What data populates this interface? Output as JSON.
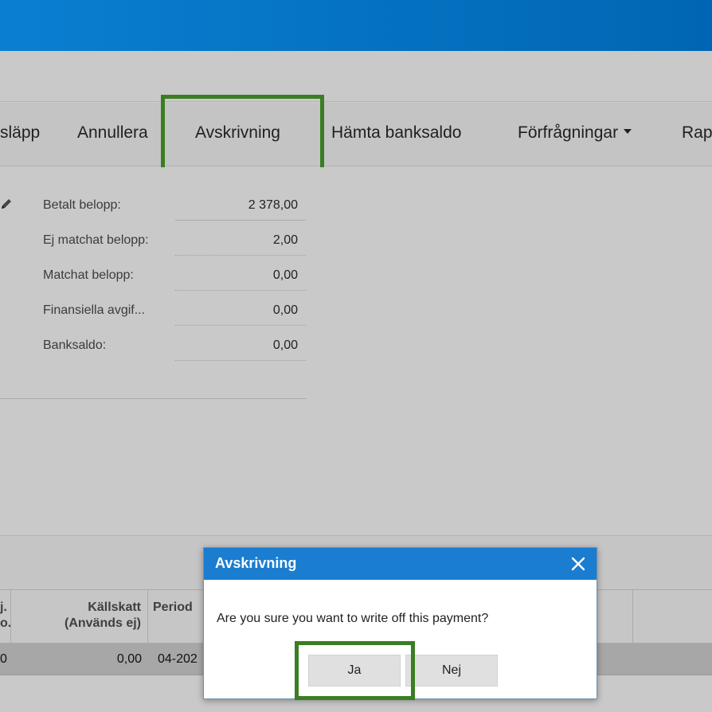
{
  "toolbar": {
    "items": [
      {
        "label": "släpp"
      },
      {
        "label": "Annullera"
      },
      {
        "label": "Avskrivning"
      },
      {
        "label": "Hämta banksaldo"
      },
      {
        "label": "Förfrågningar"
      },
      {
        "label": "Rap"
      }
    ]
  },
  "summary": {
    "rows": [
      {
        "label": "Betalt belopp:",
        "value": "2 378,00"
      },
      {
        "label": "Ej matchat belopp:",
        "value": "2,00"
      },
      {
        "label": "Matchat belopp:",
        "value": "0,00"
      },
      {
        "label": "Finansiella avgif...",
        "value": "0,00"
      },
      {
        "label": "Banksaldo:",
        "value": "0,00"
      }
    ]
  },
  "grid": {
    "headers": {
      "col1_line1": "j.",
      "col1_line2": "o.",
      "kallskatt_line1": "Källskatt",
      "kallskatt_line2": "(Används ej)",
      "period": "Period"
    },
    "row": {
      "col1": "0",
      "kallskatt": "0,00",
      "period": "04-202"
    }
  },
  "dialog": {
    "title": "Avskrivning",
    "message": "Are you sure you want to write off this payment?",
    "yes_label": "Ja",
    "no_label": "Nej"
  },
  "colors": {
    "topbar": "#0a7fd1",
    "dialog_header": "#1a7dcf",
    "highlight": "#3a7d22"
  }
}
